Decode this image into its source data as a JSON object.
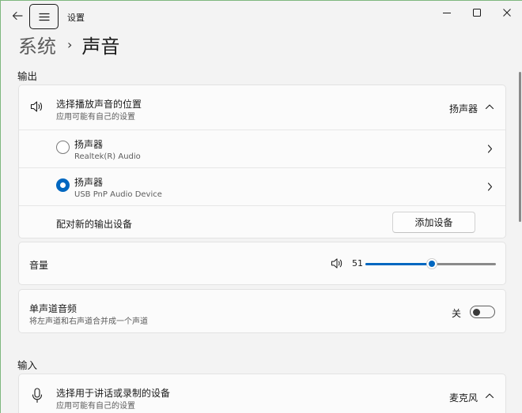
{
  "window": {
    "app_title": "设置",
    "accent_color": "#0067c0"
  },
  "breadcrumb": {
    "parent": "系统",
    "separator": "›",
    "current": "声音"
  },
  "output": {
    "section_label": "输出",
    "select_device": {
      "title": "选择播放声音的位置",
      "subtitle": "应用可能有自己的设置",
      "value": "扬声器",
      "icon": "speaker-icon",
      "expanded": true
    },
    "devices": [
      {
        "name": "扬声器",
        "detail": "Realtek(R) Audio",
        "selected": false
      },
      {
        "name": "扬声器",
        "detail": "USB PnP Audio Device",
        "selected": true
      }
    ],
    "pair_new": {
      "label": "配对新的输出设备",
      "button_label": "添加设备"
    }
  },
  "volume": {
    "label": "音量",
    "value": "51",
    "level_percent": 51,
    "icon": "speaker-icon"
  },
  "mono_audio": {
    "title": "单声道音频",
    "subtitle": "将左声道和右声道合并成一个声道",
    "state_label": "关",
    "on": false
  },
  "input": {
    "section_label": "输入",
    "select_device": {
      "title": "选择用于讲话或录制的设备",
      "subtitle": "应用可能有自己的设置",
      "value": "麦克风",
      "icon": "microphone-icon",
      "expanded": true
    }
  }
}
